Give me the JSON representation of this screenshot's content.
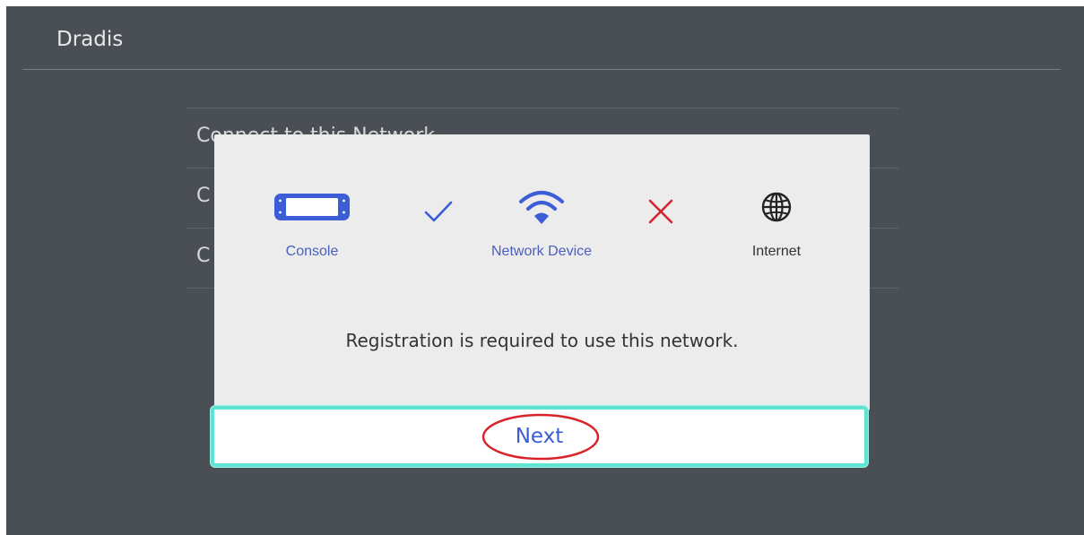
{
  "header": {
    "title": "Dradis"
  },
  "background_menu": {
    "items": [
      {
        "label": "Connect to this Network"
      },
      {
        "label": "C"
      },
      {
        "label": "C"
      }
    ]
  },
  "dialog": {
    "flow": {
      "console": {
        "label": "Console",
        "icon": "console-icon"
      },
      "link1_status": {
        "icon": "checkmark-icon"
      },
      "network_device": {
        "label": "Network Device",
        "icon": "wifi-icon"
      },
      "link2_status": {
        "icon": "cross-icon"
      },
      "internet": {
        "label": "Internet",
        "icon": "globe-icon"
      }
    },
    "message": "Registration is required to use this network.",
    "next_button": {
      "label": "Next"
    }
  },
  "colors": {
    "accent_blue": "#3c5dd6",
    "label_blue": "#4a5fbf",
    "error_red": "#d3262b",
    "focus_teal": "#5fe3d3",
    "annotation_red": "#d8232a",
    "background": "#4a4f56",
    "dialog_bg": "#ececec"
  }
}
